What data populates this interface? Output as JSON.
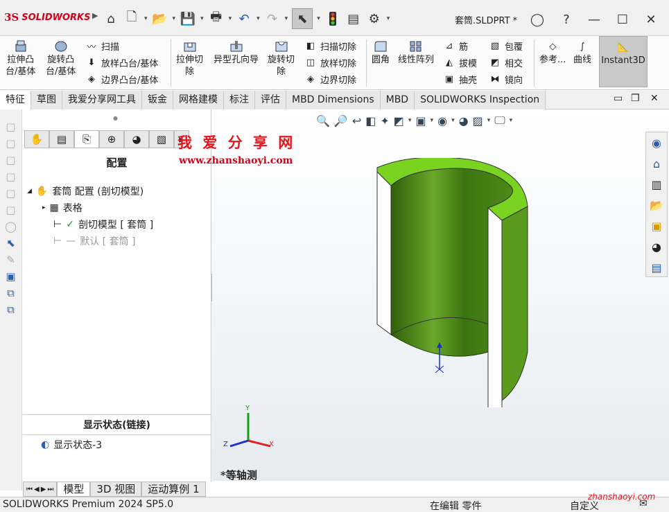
{
  "app": {
    "logo_ds": "3S",
    "logo_text": "SOLIDWORKS",
    "document_title": "套筒.SLDPRT *"
  },
  "titlebar": {
    "icons": [
      "home-icon",
      "new-document-icon",
      "open-icon",
      "save-icon",
      "print-icon",
      "undo-icon",
      "redo-icon",
      "select-icon",
      "traffic-light-icon",
      "file-properties-icon",
      "options-icon",
      "user-icon",
      "help-icon",
      "minimize-icon",
      "maximize-icon",
      "close-icon"
    ]
  },
  "command_manager": {
    "big_buttons": [
      {
        "label1": "拉伸凸",
        "label2": "台/基体"
      },
      {
        "label1": "旋转凸",
        "label2": "台/基体"
      },
      {
        "label1": "拉伸切",
        "label2": "除"
      },
      {
        "label1": "异型孔向导",
        "label2": ""
      },
      {
        "label1": "旋转切",
        "label2": "除"
      },
      {
        "label1": "圆角",
        "label2": ""
      },
      {
        "label1": "线性阵列",
        "label2": ""
      },
      {
        "label1": "参考...",
        "label2": ""
      },
      {
        "label1": "曲线",
        "label2": ""
      },
      {
        "label1": "Instant3D",
        "label2": ""
      }
    ],
    "small_col1": [
      "扫描",
      "放样凸台/基体",
      "边界凸台/基体"
    ],
    "small_col2": [
      "扫描切除",
      "放样切除",
      "边界切除"
    ],
    "small_col3": [
      "筋",
      "拔模",
      "抽壳"
    ],
    "small_col4": [
      "包覆",
      "相交",
      "镜向"
    ]
  },
  "tabs": [
    "特征",
    "草图",
    "我爱分享网工具",
    "钣金",
    "网格建模",
    "标注",
    "评估",
    "MBD Dimensions",
    "MBD",
    "SOLIDWORKS Inspection"
  ],
  "panel": {
    "title": "配置",
    "tree": {
      "root": "套筒 配置 (剖切模型)",
      "table": "表格",
      "config_active": "剖切模型 [ 套筒 ]",
      "config_default": "默认 [ 套筒 ]"
    },
    "display_state_header": "显示状态(链接)",
    "display_state_item": "显示状态-3"
  },
  "watermark": {
    "title": "我 爱 分 享 网",
    "url": "www.zhanshaoyi.com",
    "corner": "zhanshaoyi.com"
  },
  "viewport": {
    "view_label": "*等轴测",
    "axis_x": "X",
    "axis_y": "Y",
    "axis_z": "Z",
    "model_color": "#7ad321"
  },
  "bottom_tabs": [
    "模型",
    "3D 视图",
    "运动算例 1"
  ],
  "status": {
    "product": "SOLIDWORKS Premium 2024 SP5.0",
    "mode": "在编辑 零件",
    "units": "自定义"
  }
}
